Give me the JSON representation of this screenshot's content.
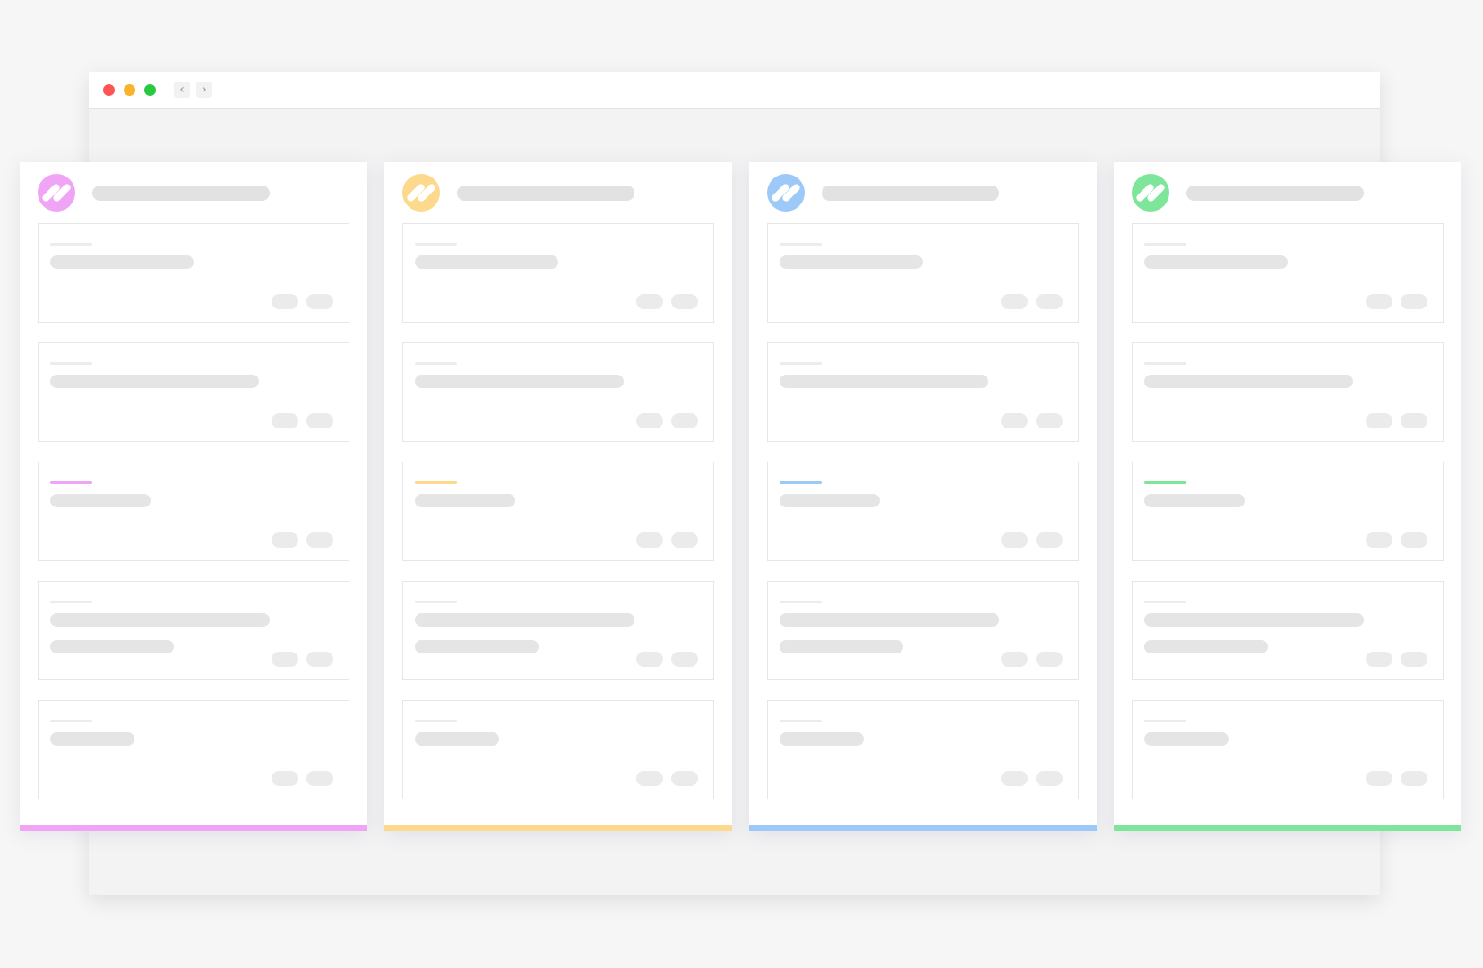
{
  "window": {
    "controls": [
      "close",
      "minimize",
      "maximize"
    ],
    "control_colors": [
      "#fd5454",
      "#fbb32b",
      "#28c840"
    ],
    "nav": {
      "back_icon": "‹",
      "forward_icon": "›"
    }
  },
  "columns": [
    {
      "name": "board-column-pink",
      "accent": "#f0a4f6",
      "icon": "pencil-icon"
    },
    {
      "name": "board-column-yellow",
      "accent": "#fdd98e",
      "icon": "pencil-icon"
    },
    {
      "name": "board-column-blue",
      "accent": "#9cc9f7",
      "icon": "pencil-icon"
    },
    {
      "name": "board-column-green",
      "accent": "#7ee69a",
      "icon": "pencil-icon"
    }
  ],
  "cards_per_column": 5,
  "highlighted_card_index": 2,
  "placeholder_colors": {
    "bar": "#e5e5e5",
    "pill": "#ebebeb",
    "border": "#e6e6e6"
  }
}
